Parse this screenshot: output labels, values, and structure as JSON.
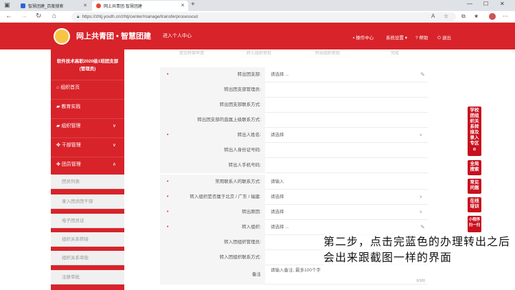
{
  "browser": {
    "tabs": [
      {
        "label": "智慧团建_百度搜索"
      },
      {
        "label": "网上共青团·智慧团建"
      }
    ],
    "url": "https://zhtj.youth.cn/zhtj/center/manage/transferprocessout"
  },
  "header": {
    "site_title": "网上共青团 • 智慧团建",
    "enter_personal": "进入个人中心",
    "manual": "操作中心",
    "settings": "系统设置",
    "help": "帮助",
    "logout": "退出"
  },
  "sidebar": {
    "org_name": "软件技术高职2020级1班团支部",
    "role": "(管理员)",
    "items": [
      {
        "label": "组织首页",
        "icon": "home-icon"
      },
      {
        "label": "教育实践",
        "icon": "folder-icon"
      },
      {
        "label": "组织管理",
        "icon": "folder-icon"
      },
      {
        "label": "干部管理",
        "icon": "users-icon"
      },
      {
        "label": "团员管理",
        "icon": "users-icon"
      }
    ],
    "subitems": [
      {
        "label": "团员列表"
      },
      {
        "label": "录入团员团干部"
      },
      {
        "label": "电子团员证"
      },
      {
        "label": "组织关系转接"
      },
      {
        "label": "组织关系审批"
      },
      {
        "label": "注册审批"
      }
    ]
  },
  "steps": [
    {
      "label": "提交转接申请"
    },
    {
      "label": "转入组织审批"
    },
    {
      "label": "转出组织审批"
    },
    {
      "label": "完成"
    }
  ],
  "form": {
    "rows": [
      {
        "label": "转出团支部:",
        "value": "请选择 ...",
        "required": true,
        "edit": true
      },
      {
        "label": "转出团支部管理员:",
        "value": "",
        "required": false
      },
      {
        "label": "转出团支部联系方式:",
        "value": "",
        "required": false
      },
      {
        "label": "转出团支部的直属上级联系方式:",
        "value": "",
        "required": false
      },
      {
        "label": "转出人姓名:",
        "value": "请选择",
        "required": true,
        "chevron": true
      },
      {
        "label": "转出人身份证号码:",
        "value": "",
        "required": false
      },
      {
        "label": "转出人手机号码:",
        "value": "",
        "required": false
      },
      {
        "label": "常用联系人的联系方式:",
        "value": "请输入",
        "required": true
      },
      {
        "label": "转入组织是否属于北京 / 广东 / 福建:",
        "value": "请选择",
        "required": true,
        "chevron": true
      },
      {
        "label": "转出原因:",
        "value": "请选择",
        "required": true,
        "chevron": true
      },
      {
        "label": "转入组织:",
        "value": "请选择 ...",
        "required": true,
        "edit": true
      },
      {
        "label": "转入团组织管理员:",
        "value": "",
        "required": false
      },
      {
        "label": "转入团组织联系方式:",
        "value": "",
        "required": false
      },
      {
        "label": "备注",
        "value": "请输入备注, 最多100个字",
        "required": false,
        "counter": "0/100"
      }
    ]
  },
  "right_toolbar": [
    {
      "label": "学校团组织关系转接及录入专区"
    },
    {
      "label": "全局搜索"
    },
    {
      "label": "常见问题"
    },
    {
      "label": "在线培训"
    },
    {
      "label": "小程序扫一扫"
    }
  ],
  "caption": "第二步，点击完蓝色的办理转出之后会出来跟截图一样的界面"
}
